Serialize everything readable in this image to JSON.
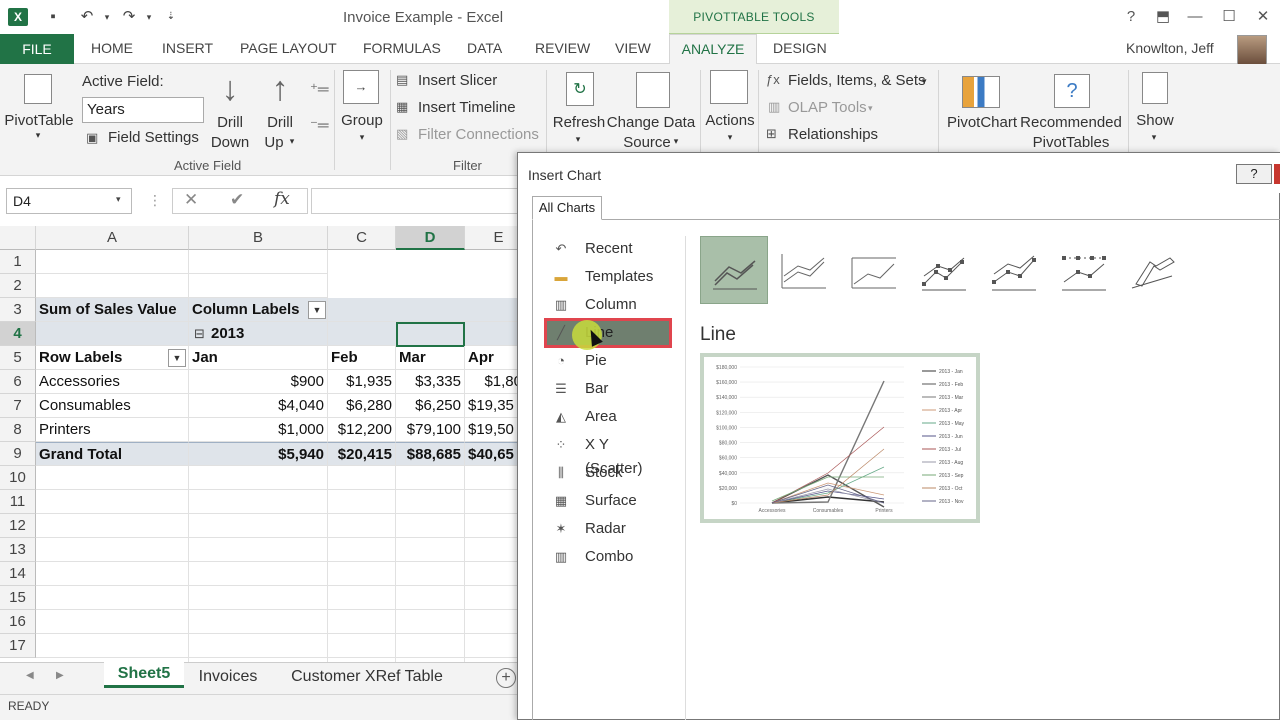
{
  "window": {
    "title": "Invoice Example - Excel",
    "contextual_tab_group": "PIVOTTABLE TOOLS",
    "help": "?"
  },
  "tabs": [
    "FILE",
    "HOME",
    "INSERT",
    "PAGE LAYOUT",
    "FORMULAS",
    "DATA",
    "REVIEW",
    "VIEW",
    "ANALYZE",
    "DESIGN"
  ],
  "user": {
    "name": "Knowlton, Jeff"
  },
  "ribbon": {
    "pivottable": "PivotTable",
    "active_field_label": "Active Field:",
    "active_field_value": "Years",
    "field_settings": "Field Settings",
    "drill_down": [
      "Drill",
      "Down"
    ],
    "drill_up": [
      "Drill",
      "Up"
    ],
    "group": "Group",
    "active_field_group": "Active Field",
    "insert_slicer": "Insert Slicer",
    "insert_timeline": "Insert Timeline",
    "filter_connections": "Filter Connections",
    "filter_group": "Filter",
    "refresh": "Refresh",
    "change_data_source": [
      "Change Data",
      "Source"
    ],
    "actions": "Actions",
    "fields_items_sets": "Fields, Items, & Sets",
    "olap_tools": "OLAP Tools",
    "relationships": "Relationships",
    "pivotchart": "PivotChart",
    "recommended_pivottables": [
      "Recommended",
      "PivotTables"
    ],
    "show": "Show"
  },
  "formula_bar": {
    "name_box": "D4",
    "fx": "fx",
    "formula": ""
  },
  "grid": {
    "columns": [
      "A",
      "B",
      "C",
      "D",
      "E"
    ],
    "rows": [
      "1",
      "2",
      "3",
      "4",
      "5",
      "6",
      "7",
      "8",
      "9",
      "10",
      "11",
      "12",
      "13",
      "14",
      "15",
      "16",
      "17"
    ],
    "pivot": {
      "sum_label": "Sum of Sales Value",
      "column_labels": "Column Labels",
      "year": "2013",
      "year_toggle": "⊟",
      "row_labels": "Row Labels",
      "months": [
        "Jan",
        "Feb",
        "Mar",
        "Apr"
      ],
      "data_rows": [
        {
          "label": "Accessories",
          "values": [
            "$900",
            "$1,935",
            "$3,335",
            "$1,80"
          ]
        },
        {
          "label": "Consumables",
          "values": [
            "$4,040",
            "$6,280",
            "$6,250",
            "$19,35"
          ]
        },
        {
          "label": "Printers",
          "values": [
            "$1,000",
            "$12,200",
            "$79,100",
            "$19,50"
          ]
        }
      ],
      "grand_total": {
        "label": "Grand Total",
        "values": [
          "$5,940",
          "$20,415",
          "$88,685",
          "$40,65"
        ]
      }
    }
  },
  "sheets": [
    "Sheet5",
    "Invoices",
    "Customer XRef Table"
  ],
  "status": "READY",
  "dialog": {
    "title": "Insert Chart",
    "tab": "All Charts",
    "chart_types": [
      {
        "label": "Recent",
        "icon": "↶"
      },
      {
        "label": "Templates",
        "icon": "▬"
      },
      {
        "label": "Column",
        "icon": "▥"
      },
      {
        "label": "Line",
        "icon": "╱"
      },
      {
        "label": "Pie",
        "icon": "◔"
      },
      {
        "label": "Bar",
        "icon": "☰"
      },
      {
        "label": "Area",
        "icon": "◭"
      },
      {
        "label": "X Y (Scatter)",
        "icon": "⁘"
      },
      {
        "label": "Stock",
        "icon": "⫼"
      },
      {
        "label": "Surface",
        "icon": "▦"
      },
      {
        "label": "Radar",
        "icon": "✶"
      },
      {
        "label": "Combo",
        "icon": "▥"
      }
    ],
    "selected_type": "Line",
    "preview": {
      "y_ticks": [
        "$180,000",
        "$160,000",
        "$140,000",
        "$120,000",
        "$100,000",
        "$80,000",
        "$60,000",
        "$40,000",
        "$20,000",
        "$0"
      ],
      "x_ticks": [
        "Accessories",
        "Consumables",
        "Printers"
      ],
      "legend": [
        "2013 - Jan",
        "2013 - Feb",
        "2013 - Mar",
        "2013 - Apr",
        "2013 - May",
        "2013 - Jun",
        "2013 - Jul",
        "2013 - Aug",
        "2013 - Sep",
        "2013 - Oct",
        "2013 - Nov"
      ]
    }
  },
  "colors": {
    "excel_green": "#217346",
    "highlight_red": "#e0454e",
    "selected_subtype": "#a9bfa9"
  }
}
